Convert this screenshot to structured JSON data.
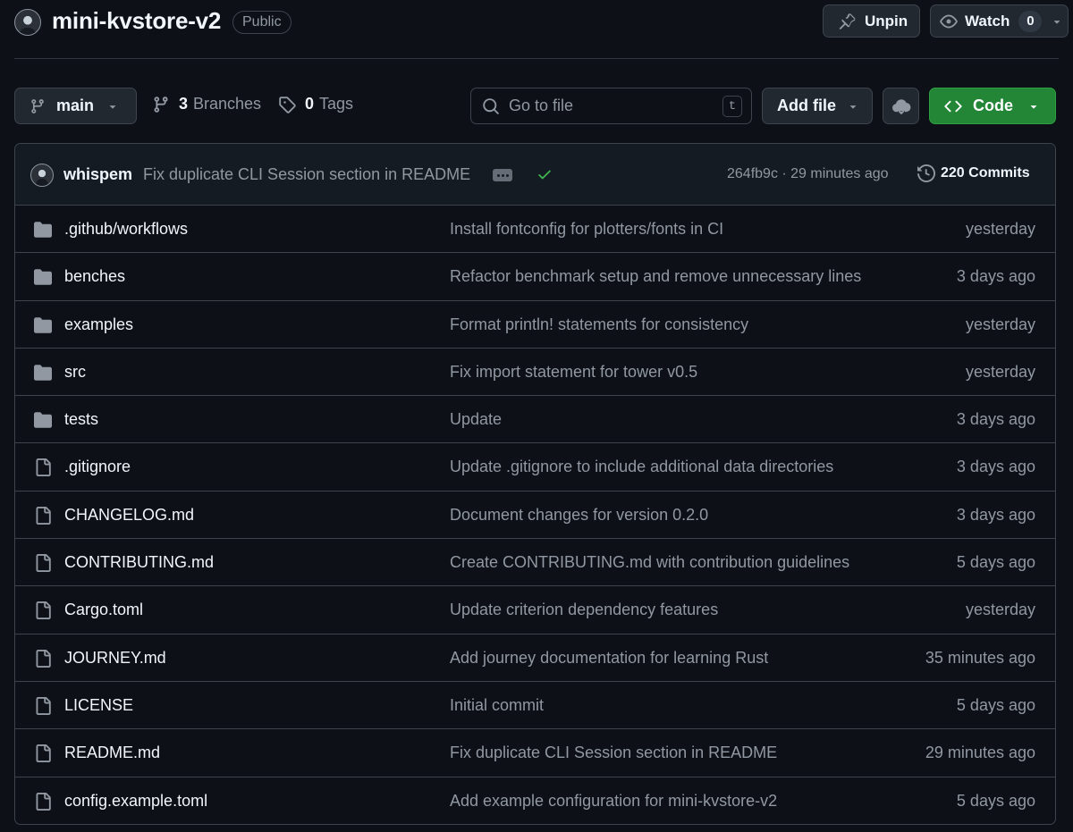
{
  "repo": {
    "name": "mini-kvstore-v2",
    "visibility": "Public"
  },
  "actions": {
    "unpin_label": "Unpin",
    "watch_label": "Watch",
    "watch_count": "0"
  },
  "toolbar": {
    "branch": "main",
    "branches_count": "3",
    "branches_label": "Branches",
    "tags_count": "0",
    "tags_label": "Tags",
    "goto_placeholder": "Go to file",
    "goto_shortcut": "t",
    "add_file_label": "Add file",
    "code_label": "Code"
  },
  "latest_commit": {
    "author": "whispem",
    "message": "Fix duplicate CLI Session section in README",
    "meta": "264fb9c · 29 minutes ago",
    "commits_label": "220 Commits"
  },
  "files": [
    {
      "type": "folder",
      "name": ".github/workflows",
      "message": "Install fontconfig for plotters/fonts in CI",
      "date": "yesterday"
    },
    {
      "type": "folder",
      "name": "benches",
      "message": "Refactor benchmark setup and remove unnecessary lines",
      "date": "3 days ago"
    },
    {
      "type": "folder",
      "name": "examples",
      "message": "Format println! statements for consistency",
      "date": "yesterday"
    },
    {
      "type": "folder",
      "name": "src",
      "message": "Fix import statement for tower v0.5",
      "date": "yesterday"
    },
    {
      "type": "folder",
      "name": "tests",
      "message": "Update",
      "date": "3 days ago"
    },
    {
      "type": "file",
      "name": ".gitignore",
      "message": "Update .gitignore to include additional data directories",
      "date": "3 days ago"
    },
    {
      "type": "file",
      "name": "CHANGELOG.md",
      "message": "Document changes for version 0.2.0",
      "date": "3 days ago"
    },
    {
      "type": "file",
      "name": "CONTRIBUTING.md",
      "message": "Create CONTRIBUTING.md with contribution guidelines",
      "date": "5 days ago"
    },
    {
      "type": "file",
      "name": "Cargo.toml",
      "message": "Update criterion dependency features",
      "date": "yesterday"
    },
    {
      "type": "file",
      "name": "JOURNEY.md",
      "message": "Add journey documentation for learning Rust",
      "date": "35 minutes ago"
    },
    {
      "type": "file",
      "name": "LICENSE",
      "message": "Initial commit",
      "date": "5 days ago"
    },
    {
      "type": "file",
      "name": "README.md",
      "message": "Fix duplicate CLI Session section in README",
      "date": "29 minutes ago"
    },
    {
      "type": "file",
      "name": "config.example.toml",
      "message": "Add example configuration for mini-kvstore-v2",
      "date": "5 days ago"
    }
  ],
  "colors": {
    "background": "#0d1117",
    "border": "#3d444d",
    "code_button": "#238636",
    "check": "#3fb950",
    "muted_text": "#9198a1"
  }
}
